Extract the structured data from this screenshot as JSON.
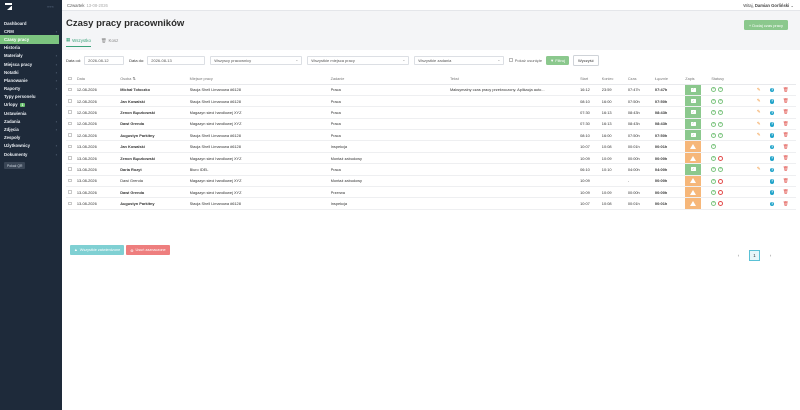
{
  "topbar": {
    "day": "Czwartek",
    "date": "13-08-2026",
    "greeting": "Witaj,",
    "user": "Damian Gorliński"
  },
  "sidebar": {
    "collapse": "«««",
    "items": [
      {
        "label": "Dashboard",
        "chev": ""
      },
      {
        "label": "CRM",
        "chev": "›"
      },
      {
        "label": "Czasy pracy",
        "chev": ""
      },
      {
        "label": "Historia",
        "chev": ""
      },
      {
        "label": "Materiały",
        "chev": "›"
      },
      {
        "label": "Miejsca pracy",
        "chev": "›"
      },
      {
        "label": "Notatki",
        "chev": "›"
      },
      {
        "label": "Planowanie",
        "chev": "›"
      },
      {
        "label": "Raporty",
        "chev": "›"
      },
      {
        "label": "Typy personelu",
        "chev": ""
      },
      {
        "label": "Urlopy",
        "chev": "›",
        "badge": "1"
      },
      {
        "label": "Ustawienia",
        "chev": ""
      },
      {
        "label": "Zadania",
        "chev": "›"
      },
      {
        "label": "Zdjęcia",
        "chev": "›"
      },
      {
        "label": "Zespoły",
        "chev": ""
      },
      {
        "label": "Użytkownicy",
        "chev": "›"
      },
      {
        "label": "Dokumenty",
        "chev": "›"
      }
    ],
    "button": "Pokaż QR"
  },
  "page": {
    "title": "Czasy pracy pracowników",
    "add_button": "+ Dodaj czas pracy"
  },
  "tabs": [
    {
      "label": "Wszystko",
      "icon": "grid-icon"
    },
    {
      "label": "Kosz",
      "icon": "trash-icon"
    }
  ],
  "filters": {
    "date_from_label": "Data od:",
    "date_from": "2026-08-12",
    "date_to_label": "Data do:",
    "date_to": "2026-08-13",
    "employees": "Wszyscy pracownicy",
    "places": "Wszystkie miejsca pracy",
    "tasks": "Wszystkie zadania",
    "show_deleted": "Pokaż usunięte",
    "filter_button": "Filtruj",
    "clear_button": "Wyczyść"
  },
  "table": {
    "headers": [
      "Data",
      "Osoba ⇅",
      "Miejsce pracy",
      "Zadanie",
      "Tekst",
      "Start",
      "Koniec",
      "Czas",
      "Łącznie",
      "Zapis",
      "Statusy"
    ],
    "rows": [
      {
        "date": "12-08-2026",
        "person": "Michał Tołoczko",
        "bold": true,
        "place": "Stacja Shell Limanowa #6128",
        "task": "Praca",
        "text": "Maksymalny czas pracy przekroczony. Aplikacja auto...",
        "start": "16:12",
        "end": "23:59",
        "time": "07:47h",
        "total": "07:47h",
        "save": "green",
        "st_ok": 2,
        "st_no": 0,
        "edit": true
      },
      {
        "date": "12-08-2026",
        "person": "Jan Kowalski",
        "bold": true,
        "place": "Stacja Shell Limanowa #6128",
        "task": "Praca",
        "text": "",
        "start": "08:10",
        "end": "16:00",
        "time": "07:50h",
        "total": "07:50h",
        "save": "green",
        "st_ok": 2,
        "st_no": 0,
        "edit": true
      },
      {
        "date": "12-08-2026",
        "person": "Zenon Bączkowski",
        "bold": true,
        "place": "Magazyn sieci handlowej XYZ",
        "task": "Praca",
        "text": "",
        "start": "07:30",
        "end": "16:13",
        "time": "08:43h",
        "total": "08:43h",
        "save": "green",
        "st_ok": 2,
        "st_no": 0,
        "edit": true
      },
      {
        "date": "12-08-2026",
        "person": "Dawi Grenda",
        "bold": true,
        "place": "Magazyn sieci handlowej XYZ",
        "task": "Praca",
        "text": "",
        "start": "07:30",
        "end": "16:13",
        "time": "08:43h",
        "total": "08:43h",
        "save": "green",
        "st_ok": 2,
        "st_no": 0,
        "edit": true
      },
      {
        "date": "12-08-2026",
        "person": "Augustyn Parkitny",
        "bold": true,
        "place": "Stacja Shell Limanowa #6128",
        "task": "Praca",
        "text": "",
        "start": "08:10",
        "end": "16:00",
        "time": "07:50h",
        "total": "07:50h",
        "save": "green",
        "st_ok": 2,
        "st_no": 0,
        "edit": true
      },
      {
        "date": "13-08-2026",
        "person": "Jan Kowalski",
        "bold": true,
        "place": "Stacja Shell Limanowa #6128",
        "task": "Inspekcja",
        "text": "",
        "start": "10:07",
        "end": "10:08",
        "time": "00:01h",
        "total": "00:01h",
        "save": "orange",
        "st_ok": 1,
        "st_no": 0,
        "edit": false
      },
      {
        "date": "13-08-2026",
        "person": "Zenon Bączkowski",
        "bold": true,
        "place": "Magazyn sieci handlowej XYZ",
        "task": "Montaż zabudowy",
        "text": "",
        "start": "10:09",
        "end": "10:09",
        "time": "00:00h",
        "total": "00:00h",
        "save": "orange",
        "st_ok": 1,
        "st_no": 1,
        "edit": false
      },
      {
        "date": "13-08-2026",
        "person": "Daria Rozyt",
        "bold": true,
        "place": "Biuro IDEL",
        "task": "Praca",
        "text": "",
        "start": "06:10",
        "end": "10:10",
        "time": "04:00h",
        "total": "04:00h",
        "save": "green",
        "st_ok": 2,
        "st_no": 0,
        "edit": true
      },
      {
        "date": "13-08-2026",
        "person": "Dawi Grenda",
        "bold": false,
        "place": "Magazyn sieci handlowej XYZ",
        "task": "Montaż zabudowy",
        "text": "",
        "start": "10:09",
        "end": "",
        "time": "-",
        "total": "00:00h",
        "save": "orange",
        "st_ok": 1,
        "st_no": 1,
        "edit": false
      },
      {
        "date": "13-08-2026",
        "person": "Dawi Grenda",
        "bold": true,
        "place": "Magazyn sieci handlowej XYZ",
        "task": "Przerwa",
        "text": "",
        "start": "10:09",
        "end": "10:09",
        "time": "00:00h",
        "total": "00:00h",
        "save": "orange",
        "st_ok": 1,
        "st_no": 1,
        "edit": false
      },
      {
        "date": "13-08-2026",
        "person": "Augustyn Parkitny",
        "bold": true,
        "place": "Stacja Shell Limanowa #6128",
        "task": "Inspekcja",
        "text": "",
        "start": "10:07",
        "end": "10:08",
        "time": "00:01h",
        "total": "00:01h",
        "save": "orange",
        "st_ok": 1,
        "st_no": 1,
        "edit": false
      }
    ]
  },
  "bulk": {
    "approve": "Wszystkie zatwierdzone",
    "delete": "Usuń zaznaczone"
  },
  "pagination": {
    "prev": "‹",
    "current": "1",
    "next": "›"
  },
  "colors": {
    "sidebar": "#1e2a3a",
    "accent": "#8bc88d",
    "save_green": "#8bc88d",
    "save_orange": "#f6b77a",
    "danger": "#e24b4b",
    "info": "#1fa3c9"
  }
}
